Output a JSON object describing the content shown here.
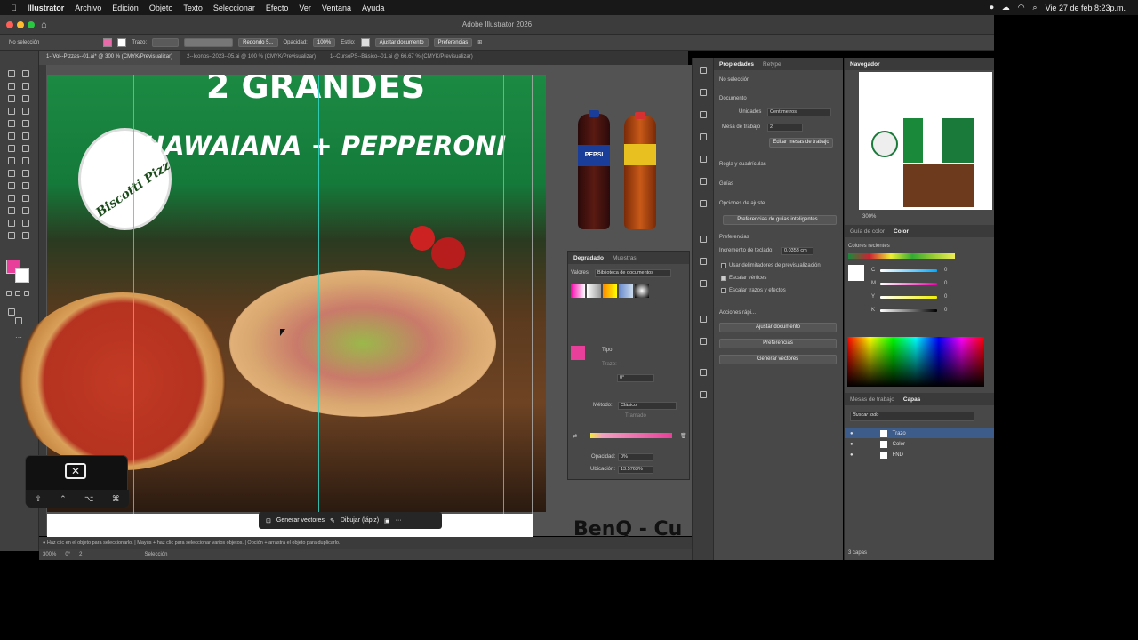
{
  "menubar": {
    "items": [
      "Illustrator",
      "Archivo",
      "Edición",
      "Objeto",
      "Texto",
      "Seleccionar",
      "Efecto",
      "Ver",
      "Ventana",
      "Ayuda"
    ],
    "datetime": "Vie 27 de feb 8:23p.m."
  },
  "window": {
    "title": "Adobe Illustrator 2026"
  },
  "control": {
    "selection": "No selección",
    "trazo_label": "Trazo:",
    "brush": "Redondo 5...",
    "opacity_label": "Opacidad:",
    "opacity": "100%",
    "style_label": "Estilo:",
    "ajustar": "Ajustar documento",
    "preferencias": "Preferencias"
  },
  "tabs": [
    "1--Vol--Pizzas--01.ai* @ 300 % (CMYK/Previsualizar)",
    "2--Iconos--2023--05.ai @ 100 % (CMYK/Previsualizar)",
    "1--CursoPS--Básico--01.ai @ 66.67 % (CMYK/Previsualizar)"
  ],
  "artwork": {
    "headline": "2 GRANDES",
    "subheadline": "HAWAIANA + PEPPERONI",
    "logo_text": "Biscotti Pizz",
    "bottle1": "PEPSI",
    "benq": "BenQ - Cu"
  },
  "context_bar": {
    "generar": "Generar vectores",
    "dibujar": "Dibujar (lápiz)"
  },
  "status": {
    "hint": "Haz clic en el objeto para seleccionarlo.  |  Mayús + haz clic para seleccionar varios objetos.  |  Opción + arrastra el objeto para duplicarlo.",
    "zoom": "300%",
    "angle": "0°",
    "artboard": "2",
    "mode": "Selección"
  },
  "gradient_panel": {
    "tab1": "Degradado",
    "tab2": "Muestras",
    "values_label": "Valores:",
    "library": "Biblioteca de documentos",
    "tipo": "Tipo:",
    "trazo": "Trazo:",
    "angle": "0°",
    "metodo_label": "Método:",
    "metodo": "Clásico",
    "tramado": "Tramado",
    "opacidad_label": "Opacidad:",
    "opacidad": "0%",
    "ubicacion_label": "Ubicación:",
    "ubicacion": "13.5763%"
  },
  "properties": {
    "tab1": "Propiedades",
    "tab2": "Retype",
    "no_sel": "No selección",
    "documento": "Documento",
    "unidades_label": "Unidades",
    "unidades": "Centímetros",
    "mesa_label": "Mesa de trabajo",
    "mesa": "2",
    "editar": "Editar mesas de trabajo",
    "regla": "Regla y cuadrículas",
    "guias": "Guías",
    "opciones_ajuste": "Opciones de ajuste",
    "pref_guias": "Preferencias de guías inteligentes...",
    "preferencias": "Preferencias",
    "incremento_label": "Incremento de teclado:",
    "incremento": "0.0353 cm",
    "chk1": "Usar delimitadores de previsualización",
    "chk2": "Escalar vértices",
    "chk3": "Escalar trazos y efectos",
    "acciones": "Acciones rápi...",
    "btn_ajustar": "Ajustar documento",
    "btn_pref": "Preferencias",
    "btn_generar": "Generar vectores"
  },
  "navigator": {
    "title": "Navegador",
    "zoom": "300%"
  },
  "color_panel": {
    "tab1": "Guía de color",
    "tab2": "Color",
    "recientes": "Colores recientes",
    "channels": [
      "C",
      "M",
      "Y",
      "K"
    ],
    "values": [
      "0",
      "0",
      "0",
      "0"
    ],
    "pct": "%"
  },
  "layers": {
    "tab1": "Mesas de trabajo",
    "tab2": "Capas",
    "search": "Buscar todo",
    "items": [
      "Trazo",
      "Color",
      "FND"
    ],
    "count": "3 capas"
  },
  "colors": {
    "layer_colors": [
      "#4a7bff",
      "#3fbf3f",
      "#4a7bff"
    ],
    "gradient_stops": [
      "#f5e642",
      "#f0a0c0",
      "#e8409a"
    ]
  }
}
